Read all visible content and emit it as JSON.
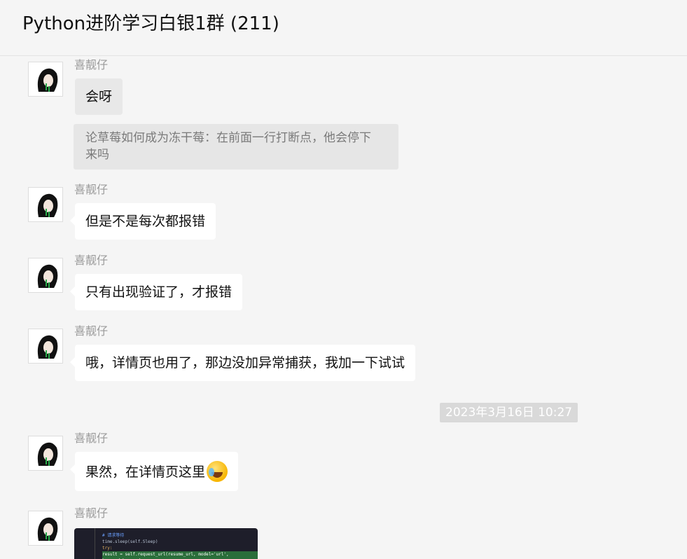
{
  "header": {
    "title": "Python进阶学习白银1群 (211)"
  },
  "messages": [
    {
      "sender": "喜靓仔",
      "text": "会呀",
      "quote": {
        "line1": "论草莓如何成为冻干莓：在前面一行打断点，他会停下",
        "line2": "来吗"
      }
    },
    {
      "sender": "喜靓仔",
      "text": "但是不是每次都报错"
    },
    {
      "sender": "喜靓仔",
      "text": "只有出现验证了，才报错"
    },
    {
      "sender": "喜靓仔",
      "text": "哦，详情页也用了，那边没加异常捕获，我加一下试试"
    },
    {
      "sender": "喜靓仔",
      "text": "果然，在详情页这里",
      "emoji": "facepalm-laugh-emoji"
    },
    {
      "sender": "喜靓仔",
      "image": "code-screenshot",
      "image_lines": [
        "# 请求等待",
        "time.sleep(self.Sleep)",
        "try:",
        "result = self.request_url(resume_url, model='url', keyword=keyword"
      ]
    }
  ],
  "timestamp": "2023年3月16日 10:27"
}
